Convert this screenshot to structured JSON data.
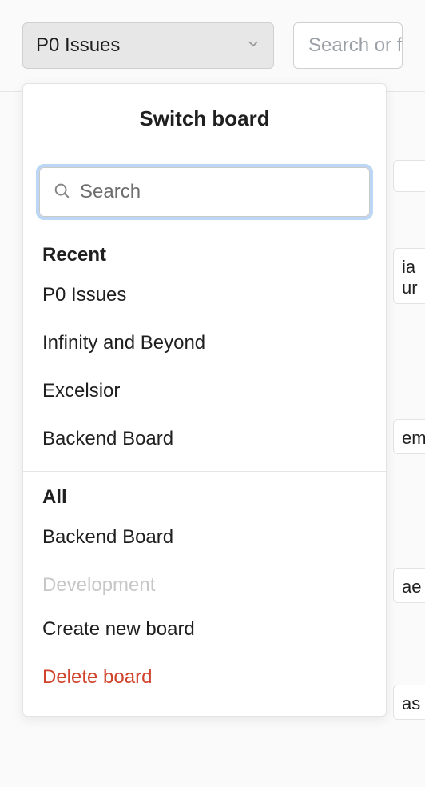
{
  "top": {
    "board_selector_label": "P0 Issues",
    "search_placeholder": "Search or f"
  },
  "dropdown": {
    "title": "Switch board",
    "search_placeholder": "Search",
    "recent_label": "Recent",
    "recent_items": [
      "P0 Issues",
      "Infinity and Beyond",
      "Excelsior",
      "Backend Board"
    ],
    "all_label": "All",
    "all_items": [
      "Backend Board",
      "Development"
    ],
    "create_label": "Create new board",
    "delete_label": "Delete board"
  },
  "bg": {
    "card1_line1": "ia",
    "card1_line2": "ur",
    "card2": "em",
    "card3": "ae",
    "card4": "as"
  }
}
